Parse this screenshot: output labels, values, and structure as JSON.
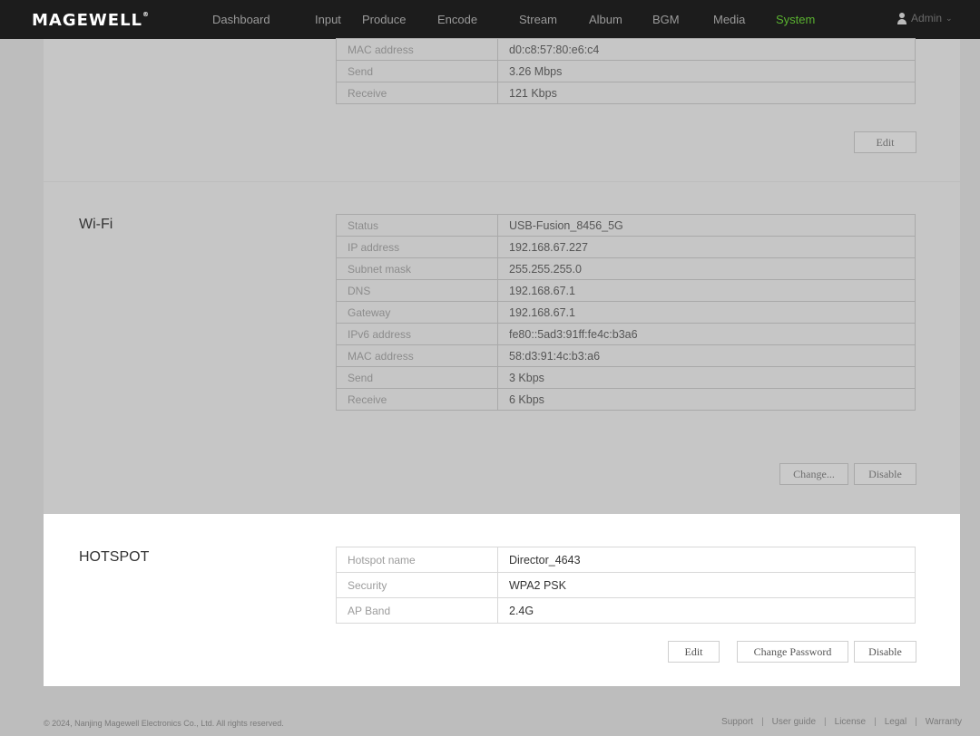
{
  "brand": {
    "name": "MAGEWELL",
    "mark": "®"
  },
  "nav": [
    {
      "label": "Dashboard"
    },
    {
      "label": "Input"
    },
    {
      "label": "Produce"
    },
    {
      "label": "Encode"
    },
    {
      "label": "Stream"
    },
    {
      "label": "Album"
    },
    {
      "label": "BGM"
    },
    {
      "label": "Media"
    },
    {
      "label": "System",
      "active": true
    }
  ],
  "user": {
    "name": "Admin",
    "icon": "user-icon",
    "chevron": "chevron-down-icon"
  },
  "lan": {
    "rows": [
      {
        "key": "MAC address",
        "value": "d0:c8:57:80:e6:c4"
      },
      {
        "key": "Send",
        "value": "3.26 Mbps"
      },
      {
        "key": "Receive",
        "value": "121 Kbps"
      }
    ],
    "edit_label": "Edit"
  },
  "wifi": {
    "title": "Wi-Fi",
    "rows": [
      {
        "key": "Status",
        "value": "USB-Fusion_8456_5G"
      },
      {
        "key": "IP address",
        "value": "192.168.67.227"
      },
      {
        "key": "Subnet mask",
        "value": "255.255.255.0"
      },
      {
        "key": "DNS",
        "value": "192.168.67.1"
      },
      {
        "key": "Gateway",
        "value": "192.168.67.1"
      },
      {
        "key": "IPv6 address",
        "value": "fe80::5ad3:91ff:fe4c:b3a6"
      },
      {
        "key": "MAC address",
        "value": "58:d3:91:4c:b3:a6"
      },
      {
        "key": "Send",
        "value": "3 Kbps"
      },
      {
        "key": "Receive",
        "value": "6 Kbps"
      }
    ],
    "change_label": "Change...",
    "disable_label": "Disable"
  },
  "hotspot": {
    "title": "HOTSPOT",
    "rows": [
      {
        "key": "Hotspot name",
        "value": "Director_4643"
      },
      {
        "key": "Security",
        "value": "WPA2 PSK"
      },
      {
        "key": "AP Band",
        "value": "2.4G"
      }
    ],
    "edit_label": "Edit",
    "change_password_label": "Change Password",
    "disable_label": "Disable"
  },
  "footer": {
    "copyright": "© 2024, Nanjing Magewell Electronics Co., Ltd. All rights reserved.",
    "links": [
      "Support",
      "User guide",
      "License",
      "Legal",
      "Warranty"
    ]
  },
  "colors": {
    "topbar": "#1c1c1c",
    "active_nav": "#5ab230",
    "overlay_gray": "#c6c6c6",
    "highlight_card": "#ffffff"
  }
}
